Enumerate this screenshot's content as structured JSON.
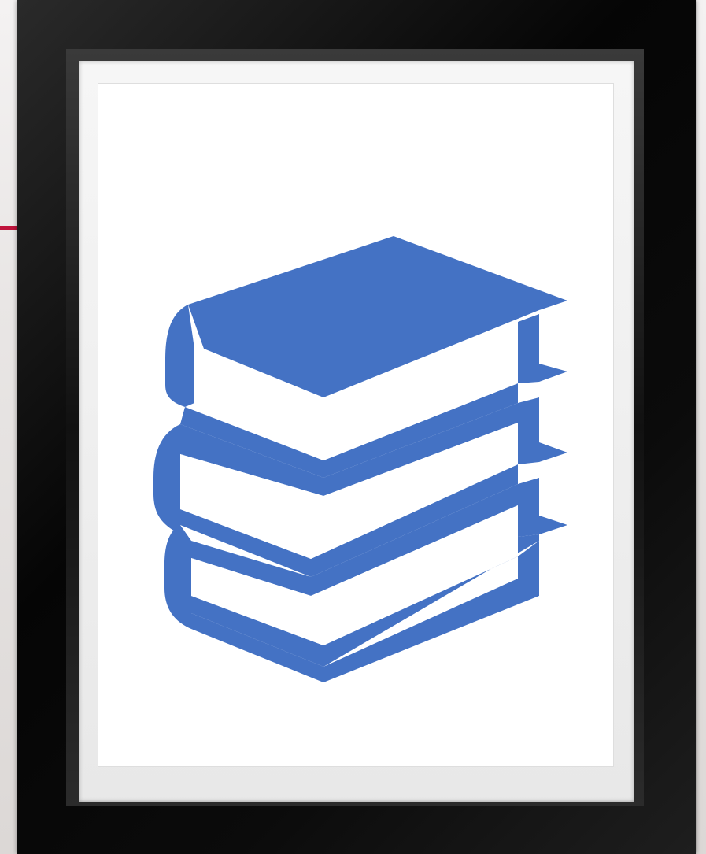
{
  "image": {
    "subject": "books-stack-icon",
    "icon_color": "#4472C4",
    "frame_color": "#0A0A0A",
    "mat_color": "#EFEFEF",
    "accent_color": "#C0143C"
  }
}
